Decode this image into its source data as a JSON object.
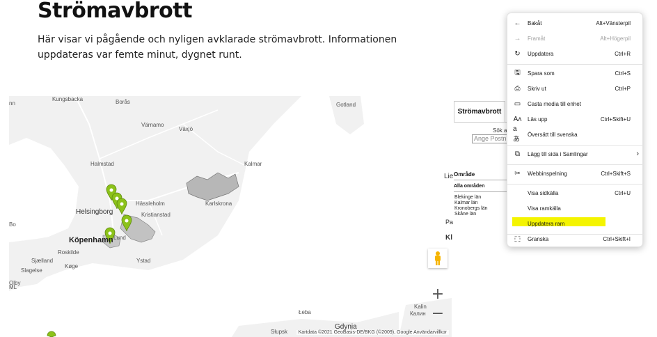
{
  "page": {
    "title": "Strömavbrott",
    "intro": "Här visar vi pågående och nyligen avklarade strömavbrott. Informationen uppdateras var femte minut, dygnet runt."
  },
  "map": {
    "places": [
      "Kungsbacka",
      "nn",
      "Borås",
      "Gotland",
      "Värnamo",
      "Växjö",
      "Halmstad",
      "Kalmar",
      "Hässleholm",
      "Karlskrona",
      "Helsingborg",
      "Kristianstad",
      "Köpenhamn",
      "Lund",
      "Roskilde",
      "Ystad",
      "Sjælland",
      "Køge",
      "Slagelse",
      "Łeba",
      "Kalin",
      "Калин",
      "Słupsk",
      "Gdynia",
      "Olby",
      "Bo",
      "ML"
    ],
    "attribution": "Kartdata ©2021 GeoBasis-DE/BKG (©2009), Google   Användarvillkor",
    "zoom_in": "+",
    "zoom_out": "−",
    "marker_color": "#8cc21a",
    "outage_area_color": "#b7b7b7"
  },
  "panel": {
    "tab": "Strömavbrott",
    "search_label": "Sök av",
    "search_placeholder": "Ange Postn",
    "lie": "Lie",
    "area_header": "Område",
    "all_areas": "Alla områden",
    "regions": [
      "Blekinge län",
      "Kalmar län",
      "Kronobergs län",
      "Skåne län"
    ],
    "pa": "Pa",
    "kl": "Kl"
  },
  "context_menu": {
    "items": [
      {
        "label": "Bakåt",
        "shortcut": "Alt+Vänsterpil",
        "icon": "back-arrow-icon",
        "glyph": "←",
        "disabled": false
      },
      {
        "label": "Framåt",
        "shortcut": "Alt+Högerpil",
        "icon": "forward-arrow-icon",
        "glyph": "→",
        "disabled": true
      },
      {
        "label": "Uppdatera",
        "shortcut": "Ctrl+R",
        "icon": "refresh-icon",
        "glyph": "↻",
        "disabled": false
      },
      {
        "label": "Spara som",
        "shortcut": "Ctrl+S",
        "icon": "save-as-icon",
        "glyph": "🖫",
        "disabled": false
      },
      {
        "label": "Skriv ut",
        "shortcut": "Ctrl+P",
        "icon": "print-icon",
        "glyph": "⎙",
        "disabled": false
      },
      {
        "label": "Casta media till enhet",
        "shortcut": "",
        "icon": "cast-icon",
        "glyph": "▭",
        "disabled": false
      },
      {
        "label": "Läs upp",
        "shortcut": "Ctrl+Skift+U",
        "icon": "read-aloud-icon",
        "glyph": "Aᴧ",
        "disabled": false
      },
      {
        "label": "Översätt till svenska",
        "shortcut": "",
        "icon": "translate-icon",
        "glyph": "aあ",
        "disabled": false
      },
      {
        "label": "Lägg till sida i Samlingar",
        "shortcut": "",
        "icon": "collections-icon",
        "glyph": "⧉",
        "disabled": false
      },
      {
        "label": "Webbinspelning",
        "shortcut": "Ctrl+Skift+S",
        "icon": "web-capture-icon",
        "glyph": "✂",
        "disabled": false
      },
      {
        "label": "Visa sidkälla",
        "shortcut": "Ctrl+U",
        "icon": "",
        "glyph": "",
        "disabled": false
      },
      {
        "label": "Visa ramkälla",
        "shortcut": "",
        "icon": "",
        "glyph": "",
        "disabled": false
      },
      {
        "label": "Uppdatera ram",
        "shortcut": "",
        "icon": "",
        "glyph": "",
        "disabled": false
      },
      {
        "label": "Granska",
        "shortcut": "Ctrl+Skift+I",
        "icon": "inspect-icon",
        "glyph": "⬚",
        "disabled": false
      }
    ],
    "submenu_chevron": "›",
    "highlight_color": "#f4f400"
  }
}
